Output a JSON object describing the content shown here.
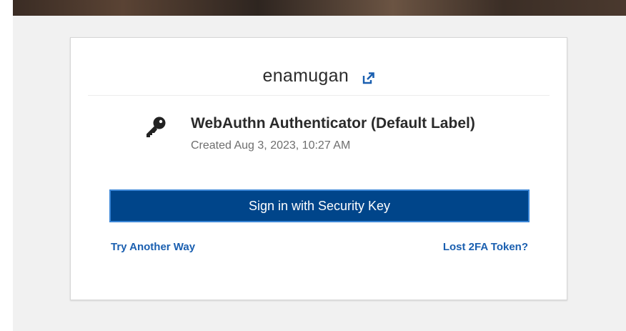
{
  "user": {
    "username": "enamugan",
    "switch_icon": "external-switch-icon"
  },
  "authenticator": {
    "icon": "key-icon",
    "name": "WebAuthn Authenticator (Default Label)",
    "created": "Created Aug 3, 2023, 10:27 AM"
  },
  "actions": {
    "signin_label": "Sign in with Security Key",
    "try_another_label": "Try Another Way",
    "lost_token_label": "Lost 2FA Token?"
  },
  "colors": {
    "button_bg": "#00458a",
    "button_border": "#3b86d6",
    "link": "#1a5fb0"
  }
}
